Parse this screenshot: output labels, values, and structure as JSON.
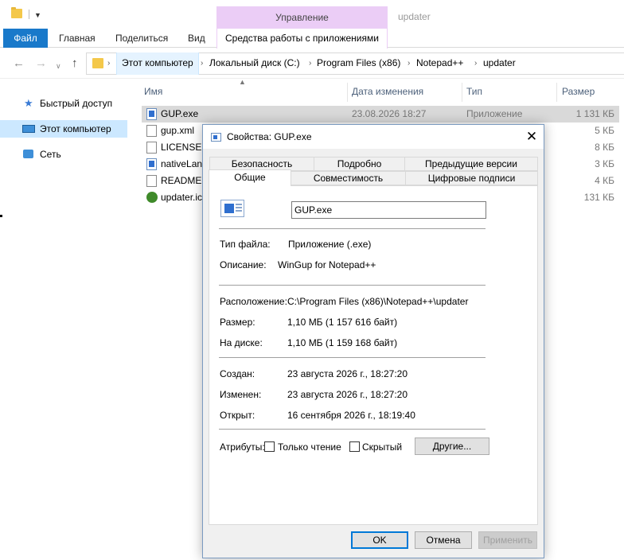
{
  "window": {
    "title": "updater"
  },
  "ribbon": {
    "context_group": "Управление",
    "tabs": [
      "Файл",
      "Главная",
      "Поделиться",
      "Вид"
    ],
    "context_tab": "Средства работы с приложениями"
  },
  "address": {
    "crumbs": [
      "Этот компьютер",
      "Локальный диск (C:)",
      "Program Files (x86)",
      "Notepad++",
      "updater"
    ]
  },
  "nav": {
    "items": [
      "Быстрый доступ",
      "Этот компьютер",
      "Сеть"
    ]
  },
  "columns": {
    "name": "Имя",
    "date": "Дата изменения",
    "type": "Тип",
    "size": "Размер"
  },
  "files": [
    {
      "name": "GUP.exe",
      "date": "23.08.2026 18:27",
      "type": "Приложение",
      "size": "1 131 КБ"
    },
    {
      "name": "gup.xml",
      "date": "",
      "type": "",
      "size": "5 КБ"
    },
    {
      "name": "LICENSE",
      "date": "",
      "type": "",
      "size": "8 КБ"
    },
    {
      "name": "nativeLan",
      "date": "",
      "type": "",
      "size": "3 КБ"
    },
    {
      "name": "README.r",
      "date": "",
      "type": "",
      "size": "4 КБ"
    },
    {
      "name": "updater.ic",
      "date": "",
      "type": "",
      "size": "131 КБ"
    }
  ],
  "dialog": {
    "title": "Свойства: GUP.exe",
    "tabs_row1": [
      "Безопасность",
      "Подробно",
      "Предыдущие версии"
    ],
    "tabs_row2": [
      "Общие",
      "Совместимость",
      "Цифровые подписи"
    ],
    "file_name": "GUP.exe",
    "file_type_label": "Тип файла:",
    "file_type": "Приложение (.exe)",
    "description_label": "Описание:",
    "description": "WinGup for Notepad++",
    "location_label": "Расположение:",
    "location": "C:\\Program Files (x86)\\Notepad++\\updater",
    "size_label": "Размер:",
    "size": "1,10 МБ (1 157 616 байт)",
    "ondisk_label": "На диске:",
    "ondisk": "1,10 МБ (1 159 168 байт)",
    "created_label": "Создан:",
    "created": "23 августа 2026 г., 18:27:20",
    "modified_label": "Изменен:",
    "modified": "23 августа 2026 г., 18:27:20",
    "accessed_label": "Открыт:",
    "accessed": "16 сентября 2026 г., 18:19:40",
    "attributes_label": "Атрибуты:",
    "readonly_label": "Только чтение",
    "hidden_label": "Скрытый",
    "other_button": "Другие...",
    "ok_button": "OK",
    "cancel_button": "Отмена",
    "apply_button": "Применить"
  }
}
